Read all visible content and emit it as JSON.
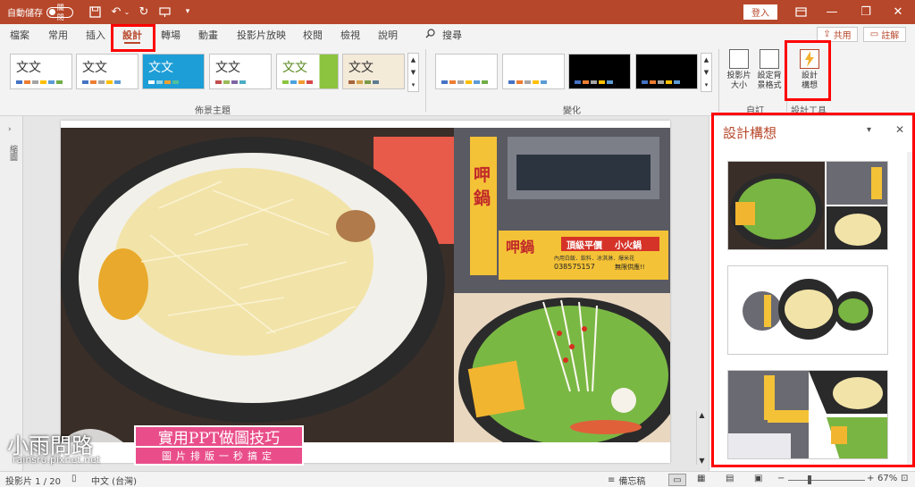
{
  "titlebar": {
    "autosave_label": "自動儲存",
    "autosave_state": "關閉",
    "signin_label": "登入",
    "minimize": "—",
    "restore": "❐",
    "close": "✕"
  },
  "tabs": [
    {
      "label": "檔案"
    },
    {
      "label": "常用"
    },
    {
      "label": "插入"
    },
    {
      "label": "設計"
    },
    {
      "label": "轉場"
    },
    {
      "label": "動畫"
    },
    {
      "label": "投影片放映"
    },
    {
      "label": "校閱"
    },
    {
      "label": "檢視"
    },
    {
      "label": "說明"
    }
  ],
  "search_label": "搜尋",
  "share_label": "共用",
  "comment_label": "註解",
  "themes": {
    "sample_text": "文文",
    "group_label": "佈景主題"
  },
  "variants_group_label": "變化",
  "customize": {
    "slide_size": "投影片大小",
    "format_background": "設定背景格式",
    "group_label": "自訂"
  },
  "designer_btn": {
    "label": "設計構想",
    "group_label": "設計工具"
  },
  "thumbnails_label": "縮圖",
  "designer_pane": {
    "title": "設計構想"
  },
  "sign_text": {
    "shop_name": "呷鍋",
    "banner_main": "頂級平價",
    "banner_sub": "小火鍋",
    "banner_items": "內用白飯．飲料．冰淇淋．爆米花",
    "phone": "038575157",
    "note": "無限供應!!"
  },
  "watermark": {
    "brand": "小雨問路",
    "site": "rainsru.pixnet.net",
    "title": "實用PPT做圖技巧",
    "subtitle": "圖片排版一秒搞定"
  },
  "status": {
    "slide_count": "投影片 1 / 20",
    "language": "中文 (台灣)",
    "notes": "備忘稿",
    "zoom": "67%"
  },
  "colors": {
    "accent": "#b7472a",
    "highlight": "#ff0000"
  }
}
